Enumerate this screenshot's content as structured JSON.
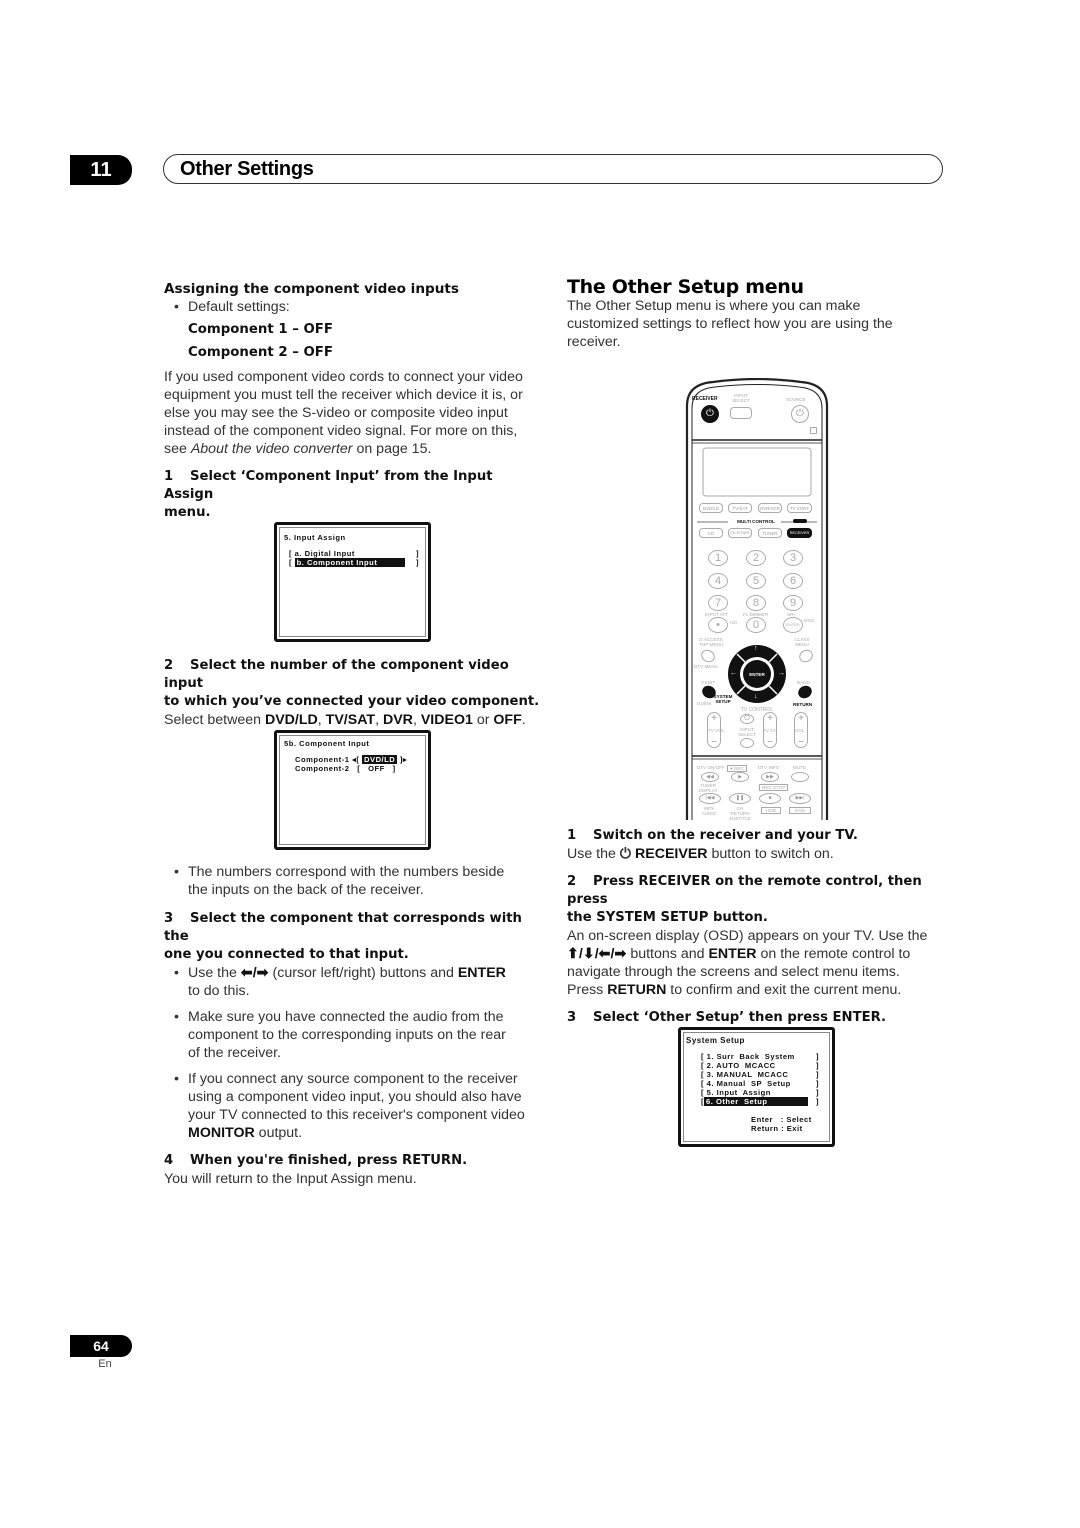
{
  "header": {
    "chapter_number": "11",
    "chapter_title": "Other Settings"
  },
  "left_column": {
    "heading": "Assigning the component video inputs",
    "default_label": "Default settings:",
    "defaults": [
      "Component 1 – OFF",
      "Component 2 – OFF"
    ],
    "intro_lines": [
      "If you used component video cords to connect your video",
      "equipment you must tell the receiver which device it is, or",
      "else you may see the S-video or composite video input",
      "instead of the component video signal. For more on this,"
    ],
    "intro_see": "see ",
    "intro_ref": "About the video converter",
    "intro_page": " on page 15.",
    "step1": {
      "num": "1",
      "text": "Select ‘Component Input’ from the Input Assign",
      "text2": "menu."
    },
    "osd1": {
      "title": "5. Input Assign",
      "items": [
        {
          "label": "a. Digital Input",
          "selected": false
        },
        {
          "label": "b. Component Input",
          "selected": true
        }
      ]
    },
    "step2": {
      "num": "2",
      "text": "Select the number of the component video input",
      "text2": "to which you’ve connected your video component."
    },
    "step2_body": {
      "prefix": "Select between ",
      "options": [
        "DVD/LD",
        "TV/SAT",
        "DVR",
        "VIDEO1",
        "OFF"
      ],
      "sep": ", ",
      "or": " or ",
      "end": "."
    },
    "osd2": {
      "title": "5b. Component Input",
      "rows": [
        {
          "label": "Component-1",
          "value": "DVD/LD",
          "selected": true
        },
        {
          "label": "Component-2",
          "value": "OFF",
          "selected": false
        }
      ]
    },
    "bullet_numbers": [
      "The numbers correspond with the numbers beside",
      "the inputs on the back of the receiver."
    ],
    "step3": {
      "num": "3",
      "text": "Select the component that corresponds with the",
      "text2": "one you connected to that input."
    },
    "bullet_use": {
      "prefix": "Use the ",
      "arrows": "⬅/➡",
      "middle": " (cursor left/right) buttons and ",
      "bold": "ENTER",
      "line2": "to do this."
    },
    "bullet_audio": [
      "Make sure you have connected the audio from the",
      "component to the corresponding inputs on the rear",
      "of the receiver."
    ],
    "bullet_monitor": [
      "If you connect any source component to the receiver",
      "using a component video input, you should also have",
      "your TV connected to this receiver's component video"
    ],
    "bullet_monitor_bold": "MONITOR",
    "bullet_monitor_end": " output.",
    "step4": {
      "num": "4",
      "text": "When you're finished, press RETURN."
    },
    "step4_body": "You will return to the Input Assign menu."
  },
  "right_column": {
    "title": "The Other Setup menu",
    "intro": [
      "The Other Setup menu is where you can make",
      "customized settings to reflect how you are using the",
      "receiver."
    ],
    "remote": {
      "receiver": "RECEIVER",
      "input_select": "INPUT SELECT",
      "source": "SOURCE",
      "row1": [
        "DVD/LD",
        "TV/SAT",
        "DVR/VCR",
        "TV CONT"
      ],
      "multi_control": "MULTI CONTROL",
      "row2": [
        "CD",
        "CD-R/TAPE",
        "TUNER",
        "RECEIVER"
      ],
      "digits": [
        "1",
        "2",
        "3",
        "4",
        "5",
        "6",
        "7",
        "8",
        "9"
      ],
      "input_att": "INPUT ATT",
      "fl_dimmer": "FL DIMMER",
      "sr_plus": "SR+",
      "disc": "DISC",
      "dot": "•",
      "plus10": "+10",
      "zero": "0",
      "enter_small": "ENTER",
      "d_access": "D.ACCESS TOP MENU",
      "class_menu": "CLASS MENU",
      "dtv_menu": "DTV MENU",
      "enter": "ENTER",
      "t_edit": "T.EDIT",
      "band": "BAND",
      "guide": "GUIDE",
      "system_setup": "SYSTEM SETUP",
      "return": "RETURN",
      "tv_control": "TV CONTROL",
      "tv_vol": "TV VOL",
      "input_select2": "INPUT SELECT",
      "tv_ch": "TV CH",
      "vol": "VOL",
      "dtv_onoff": "DTV ON/OFF",
      "rec": "● REC",
      "dtv_info": "DTV INFO",
      "mute": "MUTE",
      "tuner_display": "TUNER DISPLAY",
      "rec_stop": "REC STOP",
      "mpx_audio": "MPX AUDIO",
      "ch_return": "CH RETURN SUBTITLE",
      "hdd": "HDD",
      "dvd": "DVD"
    },
    "step1": {
      "num": "1",
      "text": "Switch on the receiver and your TV."
    },
    "step1_body": {
      "prefix": "Use the ",
      "icon": "⏻",
      "bold": " RECEIVER",
      "end": " button to switch on."
    },
    "step2": {
      "num": "2",
      "text": "Press RECEIVER on the remote control, then press",
      "text2": "the SYSTEM SETUP button."
    },
    "step2_body": {
      "line1": "An on-screen display (OSD) appears on your TV. Use the",
      "arrows": "⬆/⬇/⬅/➡",
      "line2_mid": " buttons and ",
      "line2_bold": "ENTER",
      "line2_end": " on the remote control to",
      "line3": "navigate through the screens and select menu items.",
      "line4_prefix": "Press ",
      "line4_bold": "RETURN",
      "line4_end": " to confirm and exit the current menu."
    },
    "step3": {
      "num": "3",
      "text": "Select ‘Other Setup’ then press ENTER."
    },
    "osd3": {
      "title": "System Setup",
      "items": [
        {
          "label": "1. Surr  Back  System",
          "selected": false
        },
        {
          "label": "2. AUTO  MCACC",
          "selected": false
        },
        {
          "label": "3. MANUAL  MCACC",
          "selected": false
        },
        {
          "label": "4. Manual  SP  Setup",
          "selected": false
        },
        {
          "label": "5. Input  Assign",
          "selected": false
        },
        {
          "label": "6. Other  Setup",
          "selected": true
        }
      ],
      "hint_enter": "Enter   : Select",
      "hint_return": "Return : Exit"
    }
  },
  "footer": {
    "page_number": "64",
    "language": "En"
  }
}
